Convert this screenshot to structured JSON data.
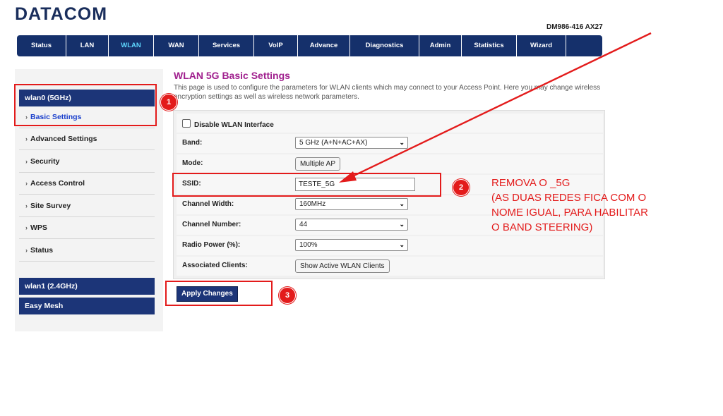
{
  "brand": "DATACOM",
  "model": "DM986-416 AX27",
  "nav": [
    {
      "label": "Status",
      "w": 70
    },
    {
      "label": "LAN",
      "w": 60
    },
    {
      "label": "WLAN",
      "w": 64,
      "active": true
    },
    {
      "label": "WAN",
      "w": 64
    },
    {
      "label": "Services",
      "w": 78
    },
    {
      "label": "VoIP",
      "w": 62
    },
    {
      "label": "Advance",
      "w": 74
    },
    {
      "label": "Diagnostics",
      "w": 98
    },
    {
      "label": "Admin",
      "w": 60
    },
    {
      "label": "Statistics",
      "w": 78
    },
    {
      "label": "Wizard",
      "w": 70
    }
  ],
  "sidebar": {
    "wlan0": "wlan0 (5GHz)",
    "items": [
      "Basic Settings",
      "Advanced Settings",
      "Security",
      "Access Control",
      "Site Survey",
      "WPS",
      "Status"
    ],
    "wlan1": "wlan1 (2.4GHz)",
    "easymesh": "Easy Mesh"
  },
  "page": {
    "title": "WLAN 5G Basic Settings",
    "desc": "This page is used to configure the parameters for WLAN clients which may connect to your Access Point. Here you may change wireless encryption settings as well as wireless network parameters."
  },
  "form": {
    "disable_label": "Disable WLAN Interface",
    "band_label": "Band:",
    "band_value": "5 GHz (A+N+AC+AX)",
    "mode_label": "Mode:",
    "mode_button": "Multiple AP",
    "ssid_label": "SSID:",
    "ssid_value": "TESTE_5G",
    "width_label": "Channel Width:",
    "width_value": "160MHz",
    "channel_label": "Channel Number:",
    "channel_value": "44",
    "power_label": "Radio Power (%):",
    "power_value": "100%",
    "clients_label": "Associated Clients:",
    "clients_button": "Show Active WLAN Clients",
    "apply": "Apply Changes"
  },
  "annotations": {
    "badge1": "1",
    "badge2": "2",
    "badge3": "3",
    "line1": "REMOVA O _5G",
    "line2": "(AS DUAS REDES FICA COM O",
    "line3": "NOME IGUAL, PARA HABILITAR",
    "line4": "O BAND STEERING)",
    "color": "#e31b1b"
  }
}
